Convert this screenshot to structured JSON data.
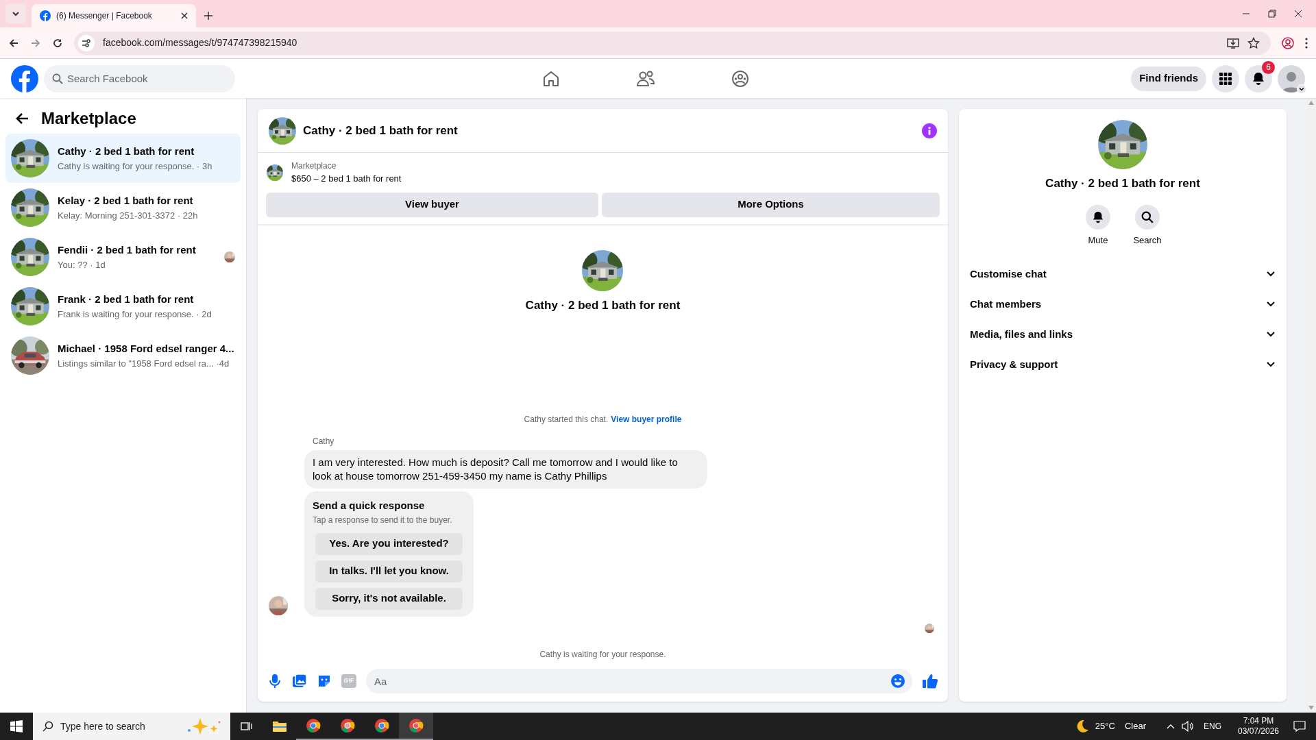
{
  "browser": {
    "tabs": [
      {
        "title": "(6) Messenger | Facebook",
        "selected": true
      }
    ],
    "url": "facebook.com/messages/t/974747398215940"
  },
  "header": {
    "search_placeholder": "Search Facebook",
    "find_friends": "Find friends",
    "notification_count": "6"
  },
  "sidebar": {
    "title": "Marketplace",
    "conversations": [
      {
        "title": "Cathy · 2 bed 1 bath for rent",
        "subtitle": "Cathy is waiting for your response. · 3h",
        "selected": true,
        "seen": false
      },
      {
        "title": "Kelay · 2 bed 1 bath for rent",
        "subtitle": "Kelay: Morning 251-301-3372 · 22h",
        "selected": false,
        "seen": false
      },
      {
        "title": "Fendii · 2 bed 1 bath for rent",
        "subtitle": "You: ?? · 1d",
        "selected": false,
        "seen": true
      },
      {
        "title": "Frank · 2 bed 1 bath for rent",
        "subtitle": "Frank is waiting for your response. · 2d",
        "selected": false,
        "seen": false
      },
      {
        "title": "Michael · 1958 Ford edsel ranger 4...",
        "subtitle": "Listings similar to \"1958 Ford edsel ra... ·4d",
        "selected": false,
        "seen": false
      }
    ]
  },
  "chat": {
    "title": "Cathy · 2 bed 1 bath for rent",
    "listing": {
      "label": "Marketplace",
      "price_title": "$650 – 2 bed 1 bath for rent"
    },
    "buttons": [
      "View buyer",
      "More Options"
    ],
    "intro_title": "Cathy · 2 bed 1 bath for rent",
    "started": {
      "text": "Cathy started this chat.",
      "link": "View buyer profile"
    },
    "messages": [
      {
        "sender": "Cathy",
        "text": "I am very interested. How much is deposit? Call me tomorrow and I would like to look at house tomorrow 251-459-3450 my name is Cathy Phillips"
      }
    ],
    "quick_response": {
      "title": "Send a quick response",
      "hint": "Tap a response to send it to the buyer.",
      "options": [
        "Yes. Are you interested?",
        "In talks. I'll let you know.",
        "Sorry, it's not available."
      ]
    },
    "status": "Cathy is waiting for your response.",
    "composer": {
      "gif_label": "GIF",
      "placeholder": "Aa"
    }
  },
  "details": {
    "title": "Cathy · 2 bed 1 bath for rent",
    "actions": [
      {
        "kind": "mute",
        "label": "Mute"
      },
      {
        "kind": "search",
        "label": "Search"
      }
    ],
    "sections": [
      {
        "label": "Customise chat",
        "expanded": false
      },
      {
        "label": "Chat members",
        "expanded": false
      },
      {
        "label": "Media, files and links",
        "expanded": false
      },
      {
        "label": "Privacy & support",
        "expanded": false
      }
    ]
  },
  "taskbar": {
    "search_placeholder": "Type here to search",
    "temperature": "25°C",
    "weather": "Clear",
    "language": "ENG",
    "time": "7:04 PM",
    "date": "03/07/2026"
  }
}
